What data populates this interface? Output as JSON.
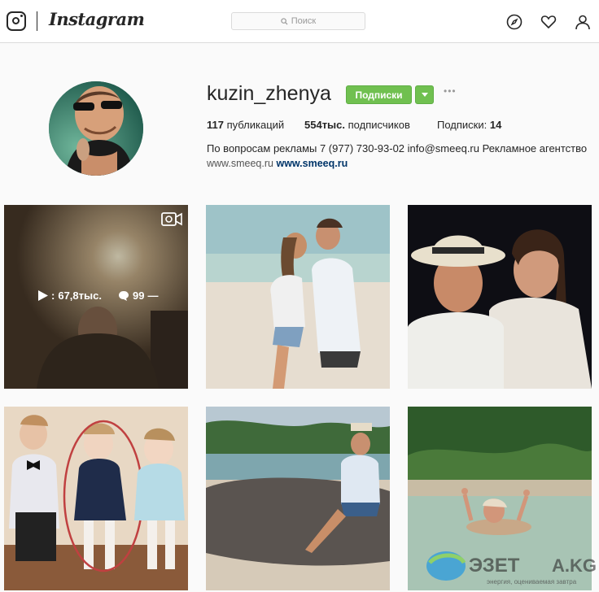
{
  "header": {
    "brand": "Instagram",
    "search_placeholder": "Поиск",
    "icons": [
      "instagram-glyph-icon",
      "explore-compass-icon",
      "heart-icon",
      "profile-icon"
    ]
  },
  "profile": {
    "username": "kuzin_zhenya",
    "follow_label": "Подписки",
    "more_label": "•••",
    "posts_count": "117",
    "posts_label": "публикаций",
    "followers_count": "554тыс.",
    "followers_label": "подписчиков",
    "following_label": "Подписки:",
    "following_count": "14",
    "bio": "По вопросам рекламы 7 (977) 730-93-02 info@smeeq.ru Рекламное агентство",
    "link_plain": "www.smeeq.ru",
    "link_bold": "www.smeeq.ru"
  },
  "grid": {
    "first_post": {
      "views": "67,8тыс.",
      "comments": "99",
      "comments_suffix": "—",
      "is_video": true
    }
  },
  "watermark": {
    "text_left": "ЭЗЕТ",
    "text_right": "A.KG",
    "tagline": "энергия, оцениваемая завтра"
  },
  "colors": {
    "follow_green": "#70c050",
    "link_blue": "#003569"
  }
}
